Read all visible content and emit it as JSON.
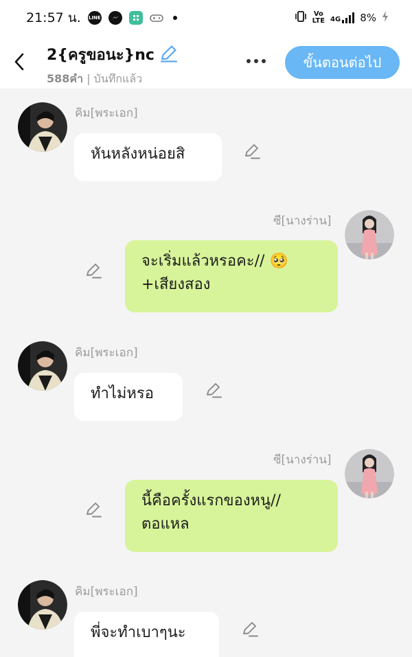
{
  "status_bar": {
    "time": "21:57 น.",
    "apps": [
      "LINE",
      "messenger",
      "calculator",
      "game"
    ],
    "network_label_top": "Vo",
    "network_label_bottom": "LTE",
    "network_type": "4G",
    "battery": "8%"
  },
  "header": {
    "title": "2{ครูขอนะ}nc",
    "word_count": "588คำ",
    "save_status": "บันทึกแล้ว",
    "next_button": "ขั้นตอนต่อไป"
  },
  "messages": [
    {
      "side": "left",
      "sender": "คิม[พระเอก]",
      "lines": [
        "หันหลังหน่อยสิ"
      ]
    },
    {
      "side": "right",
      "sender": "ซี[นางร่าน]",
      "lines": [
        "จะเริ่มแล้วหรอคะ// 🥺",
        "+เสียงสอง"
      ]
    },
    {
      "side": "left",
      "sender": "คิม[พระเอก]",
      "lines": [
        "ทำไม่หรอ"
      ]
    },
    {
      "side": "right",
      "sender": "ซี[นางร่าน]",
      "lines": [
        "นี้คือครั้งแรกของหนู//",
        "ตอแหล"
      ]
    },
    {
      "side": "left",
      "sender": "คิม[พระเอก]",
      "lines": [
        "พี่จะทำเบาๆนะ"
      ]
    }
  ],
  "colors": {
    "accent_button": "#69b7f4",
    "right_bubble": "#d8f49a",
    "left_bubble": "#ffffff",
    "background": "#f4f4f4"
  }
}
